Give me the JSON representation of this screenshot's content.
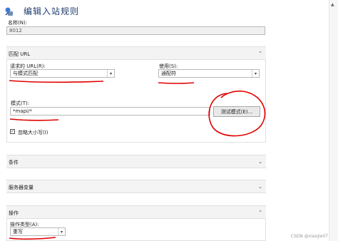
{
  "header": {
    "title": "编辑入站规则"
  },
  "name_field": {
    "label": "名称(N):",
    "value": "8012"
  },
  "match_url": {
    "section_title": "匹配 URL",
    "requested_url_label": "请求的 URL(R):",
    "requested_url_value": "与模式匹配",
    "using_label": "使用(S):",
    "using_value": "通配符",
    "pattern_label": "模式(T):",
    "pattern_value": "*mapi/*",
    "test_button": "测试模式(E)...",
    "ignore_case_label": "忽略大小写(I)",
    "ignore_case_checked": "✓"
  },
  "conditions": {
    "section_title": "条件"
  },
  "server_variables": {
    "section_title": "服务器变量"
  },
  "action": {
    "section_title": "操作",
    "type_label": "操作类型(A):",
    "type_value": "重写"
  },
  "watermark": "CSDN @xiaojie07",
  "icons": {
    "collapse": "collapse-up-icon",
    "expand": "expand-down-icon",
    "dropdown": "chevron-down-icon"
  },
  "colors": {
    "annotation": "#e00000",
    "title": "#1e3c6e"
  }
}
